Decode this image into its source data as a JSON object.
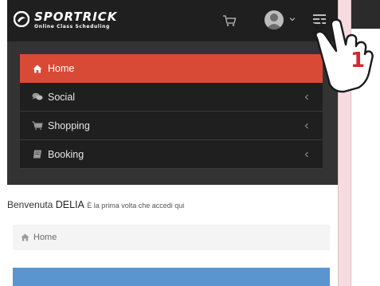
{
  "brand": {
    "title": "SPORTRICK",
    "subtitle": "Online Class Scheduling"
  },
  "topbar": {
    "cart_icon": "cart-icon",
    "avatar_icon": "user-avatar",
    "caret_icon": "chevron-down-icon",
    "menu_icon": "hamburger-icon"
  },
  "menu": {
    "items": [
      {
        "label": "Home",
        "icon": "home-icon",
        "active": true
      },
      {
        "label": "Social",
        "icon": "chat-bubbles-icon",
        "active": false
      },
      {
        "label": "Shopping",
        "icon": "cart-icon",
        "active": false
      },
      {
        "label": "Booking",
        "icon": "book-icon",
        "active": false
      }
    ]
  },
  "welcome": {
    "greeting": "Benvenuta",
    "name": "DELIA",
    "hint": "È la prima volta che accedi qui"
  },
  "breadcrumb": {
    "label": "Home",
    "icon": "home-icon"
  },
  "annotation": {
    "step": "1"
  },
  "colors": {
    "topbar": "#1f1f1f",
    "panel": "#333333",
    "active": "#d94a36",
    "accent_box": "#5b95cf",
    "background": "#f6dbe0"
  }
}
